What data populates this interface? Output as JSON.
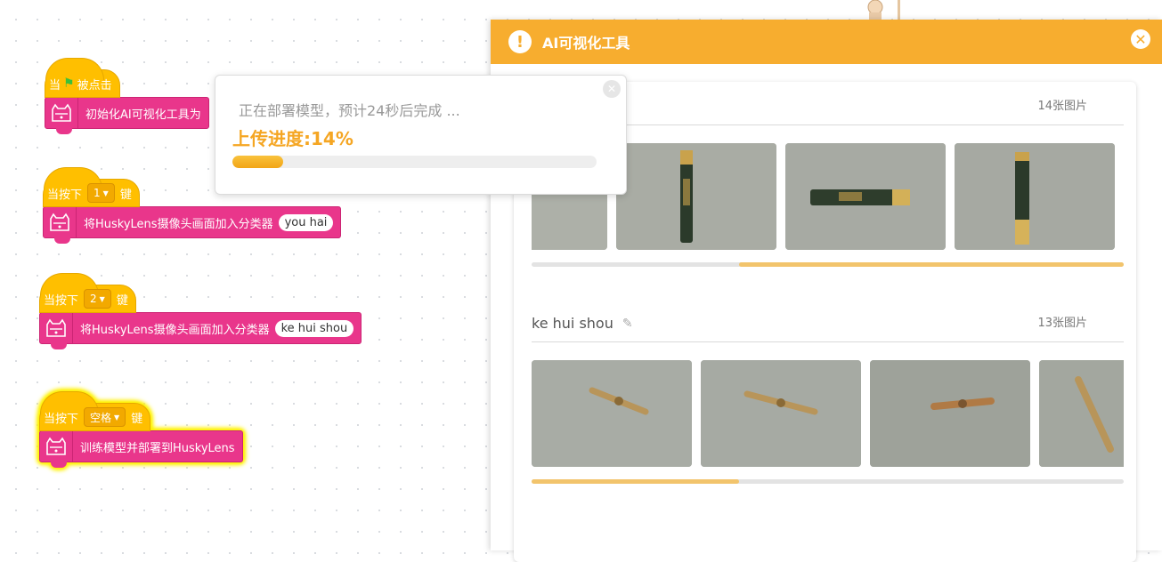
{
  "blocks": {
    "script1": {
      "hat_when": "当",
      "hat_clicked": "被点击",
      "cmd": "初始化AI可视化工具为"
    },
    "script2": {
      "hat_when": "当按下",
      "key": "1",
      "hat_key": "键",
      "cmd": "将HuskyLens摄像头画面加入分类器",
      "arg": "you hai"
    },
    "script3": {
      "hat_when": "当按下",
      "key": "2",
      "hat_key": "键",
      "cmd": "将HuskyLens摄像头画面加入分类器",
      "arg": "ke hui shou"
    },
    "script4": {
      "hat_when": "当按下",
      "key": "空格",
      "hat_key": "键",
      "cmd": "训练模型并部署到HuskyLens"
    }
  },
  "popup": {
    "message": "正在部署模型，预计24秒后完成 ...",
    "progress_label": "上传进度:14%",
    "progress_fraction": 0.14
  },
  "panel": {
    "title": "AI可视化工具",
    "sections": [
      {
        "name": "",
        "count": "14张图片",
        "scroll_fraction": 0.65
      },
      {
        "name": "ke hui shou",
        "count": "13张图片",
        "scroll_fraction": 0.35
      }
    ]
  },
  "colors": {
    "accent": "#f7ad2f",
    "event_block": "#ffbf00",
    "husky_block": "#e9368b",
    "progress": "#f5a623"
  }
}
